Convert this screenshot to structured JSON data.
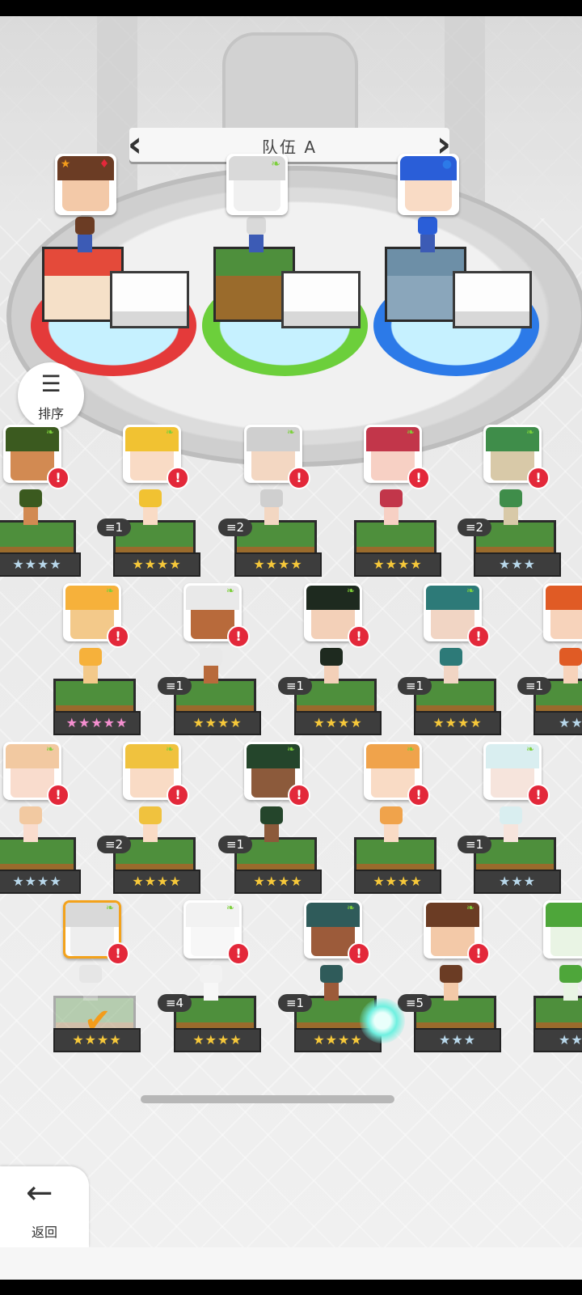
{
  "team": {
    "title": "队伍 A",
    "prev_icon": "chevron-left-icon",
    "next_icon": "chevron-right-icon"
  },
  "sort": {
    "label": "排序",
    "icon": "sort-icon"
  },
  "back": {
    "label": "返回",
    "icon": "arrow-left-icon"
  },
  "team_slots": [
    {
      "hair": "#6b3c24",
      "face": "#f3c9a8",
      "color": "#e43a3a",
      "block_top": "#e44a3a",
      "block_side": "#f5e0c8",
      "icons": [
        "star-icon",
        "card-icon"
      ]
    },
    {
      "hair": "#d9d9d9",
      "face": "#f0f0f0",
      "color": "#6ccf3b",
      "block_top": "#4e8f3c",
      "block_side": "#9a6b2c",
      "icons": [
        "leaf-icon"
      ]
    },
    {
      "hair": "#2a5ed8",
      "face": "#f9dbc5",
      "color": "#2c7ae8",
      "block_top": "#6d8fa7",
      "block_side": "#8aa6bb",
      "icons": [
        "water-icon"
      ]
    }
  ],
  "roster": [
    {
      "lvl": "",
      "stars": "★★★★",
      "star_type": "silver",
      "hair": "#3b5a1f",
      "face": "#d28a52"
    },
    {
      "lvl": "1",
      "stars": "★★★★",
      "star_type": "gold",
      "hair": "#f1c232",
      "face": "#f9dbc5"
    },
    {
      "lvl": "2",
      "stars": "★★★★",
      "star_type": "gold",
      "hair": "#cfcfcf",
      "face": "#f3d7c2"
    },
    {
      "lvl": "",
      "stars": "★★★★",
      "star_type": "gold",
      "hair": "#c2364a",
      "face": "#f7d0c4"
    },
    {
      "lvl": "2",
      "stars": "★★★",
      "star_type": "silver",
      "hair": "#3f8d4a",
      "face": "#d8c9a8"
    },
    {
      "lvl": "",
      "stars": "★★★★★",
      "star_type": "rainbow",
      "hair": "#f6b13b",
      "face": "#f3c98a"
    },
    {
      "lvl": "1",
      "stars": "★★★★",
      "star_type": "gold",
      "hair": "#e9e9e9",
      "face": "#b86a3b"
    },
    {
      "lvl": "1",
      "stars": "★★★★",
      "star_type": "gold",
      "hair": "#1e2a1f",
      "face": "#f3d0b8"
    },
    {
      "lvl": "1",
      "stars": "★★★★",
      "star_type": "gold",
      "hair": "#2d7a78",
      "face": "#f1d5c4"
    },
    {
      "lvl": "1",
      "stars": "★★★",
      "star_type": "silver",
      "hair": "#e05b25",
      "face": "#f7d3bb"
    },
    {
      "lvl": "",
      "stars": "★★★★",
      "star_type": "silver",
      "hair": "#f2c9a1",
      "face": "#f9dccd"
    },
    {
      "lvl": "2",
      "stars": "★★★★",
      "star_type": "gold",
      "hair": "#f0c23e",
      "face": "#f9dbc5"
    },
    {
      "lvl": "1",
      "stars": "★★★★",
      "star_type": "gold",
      "hair": "#24452b",
      "face": "#8c5a3b"
    },
    {
      "lvl": "",
      "stars": "★★★★",
      "star_type": "gold",
      "hair": "#f0a34b",
      "face": "#f9dbc5"
    },
    {
      "lvl": "1",
      "stars": "★★★",
      "star_type": "silver",
      "hair": "#d9eef0",
      "face": "#f6e4dc"
    },
    {
      "lvl": "",
      "stars": "★★★★",
      "star_type": "gold",
      "hair": "#d9d9d9",
      "face": "#eeeeee",
      "selected": true
    },
    {
      "lvl": "4",
      "stars": "★★★★",
      "star_type": "gold",
      "hair": "#f2f2f2",
      "face": "#f7f7f7"
    },
    {
      "lvl": "1",
      "stars": "★★★★",
      "star_type": "gold",
      "hair": "#2f5b5a",
      "face": "#9c5b3a"
    },
    {
      "lvl": "5",
      "stars": "★★★",
      "star_type": "silver",
      "hair": "#6b3c24",
      "face": "#f3c9a8"
    },
    {
      "lvl": "",
      "stars": "★★★",
      "star_type": "silver",
      "hair": "#4ea63a",
      "face": "#e9f4e4"
    }
  ],
  "colors": {
    "alert": "#e3283a",
    "select": "#f3a21b",
    "leaf": "#7ccf3a"
  }
}
